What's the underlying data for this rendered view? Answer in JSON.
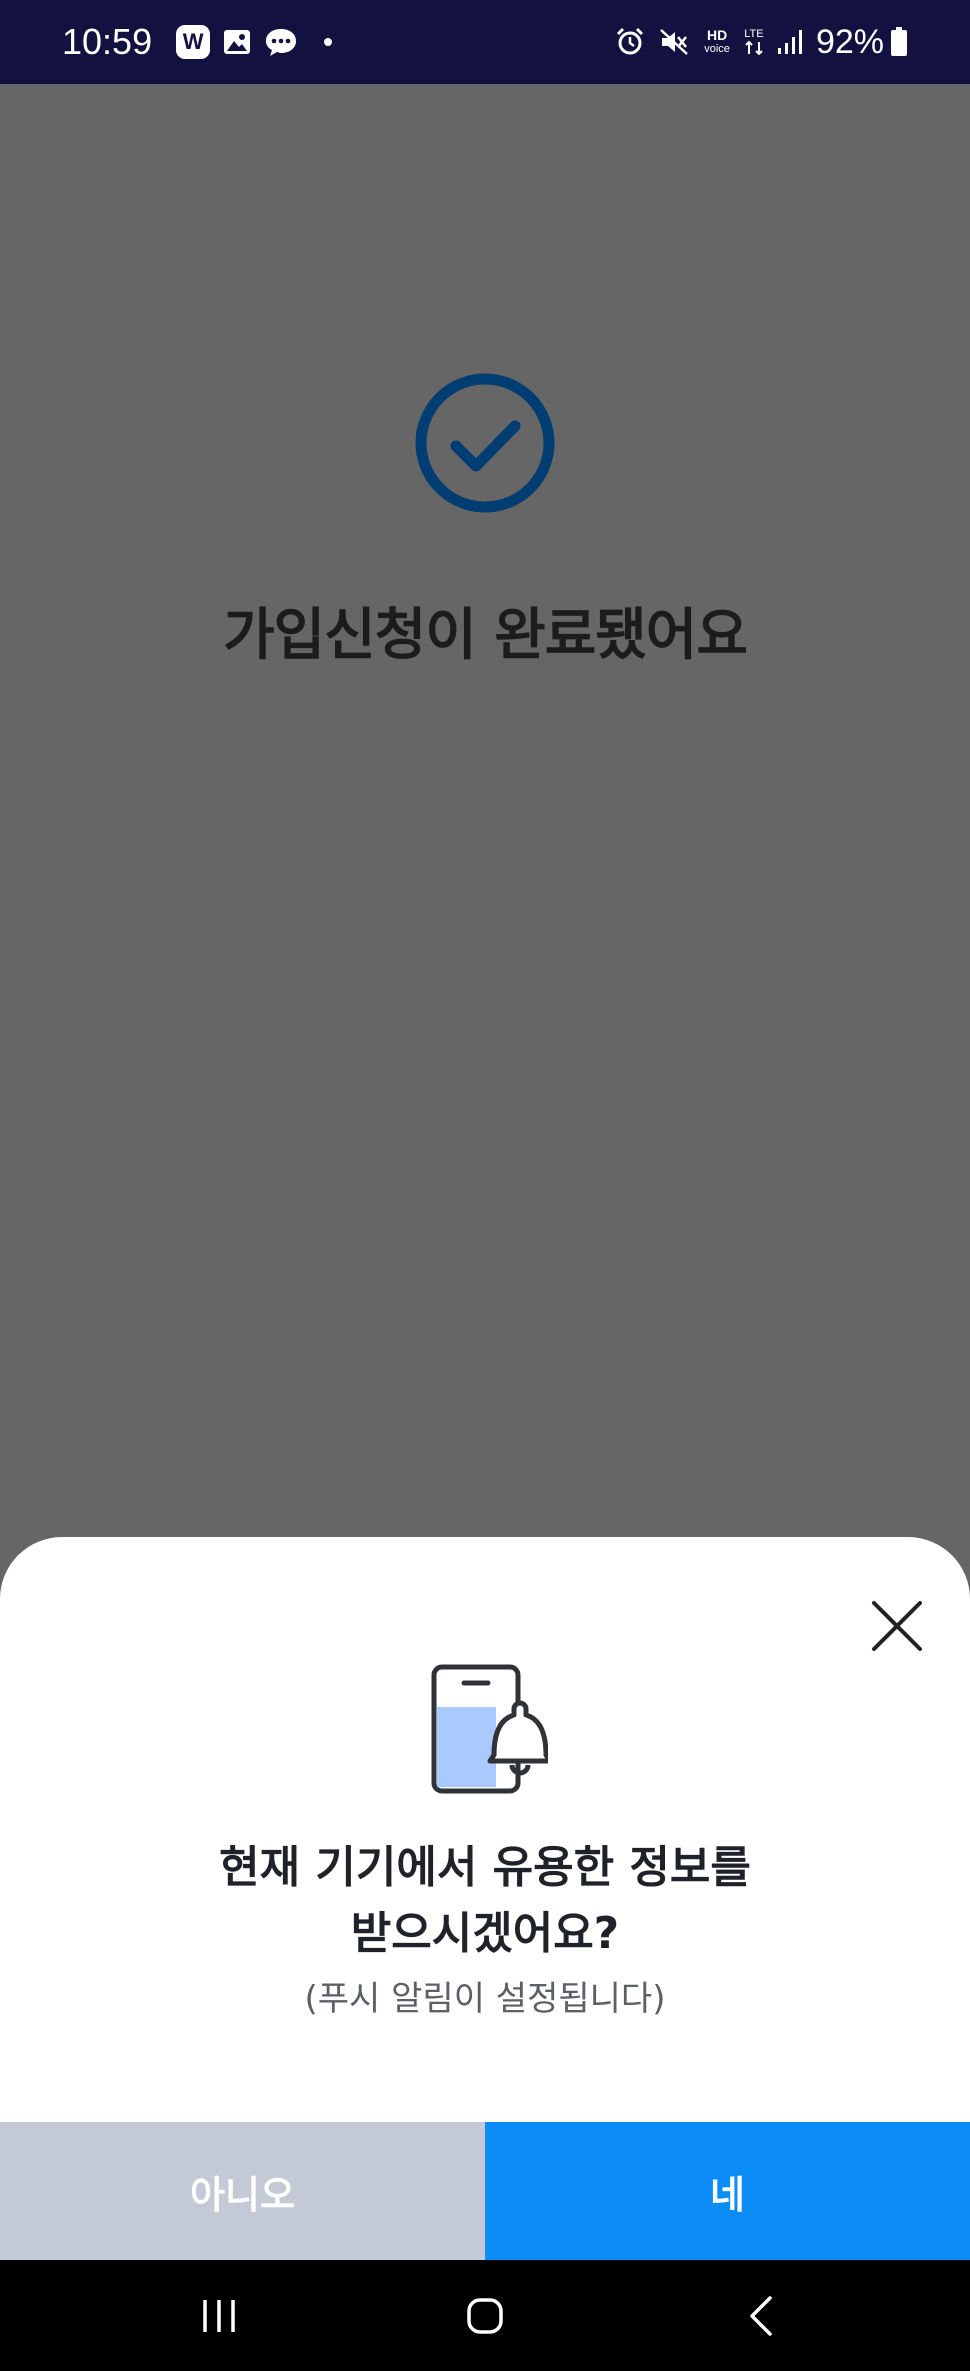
{
  "status_bar": {
    "time": "10:59",
    "app_icon_letter": "W",
    "network_top": "HD",
    "network_bottom": "voice",
    "lte": "LTE",
    "battery": "92%"
  },
  "main": {
    "title": "가입신청이 완료됐어요",
    "accent_color": "#003d73"
  },
  "sheet": {
    "title_line1": "현재 기기에서 유용한 정보를",
    "title_line2": "받으시겠어요?",
    "subtitle": "(푸시 알림이 설정됩니다)",
    "no_label": "아니오",
    "yes_label": "네",
    "yes_color": "#0b8cf7",
    "no_color": "#c3cad6"
  },
  "icons": {
    "check": "check-circle-icon",
    "close": "close-icon",
    "illustration": "phone-bell-icon"
  }
}
